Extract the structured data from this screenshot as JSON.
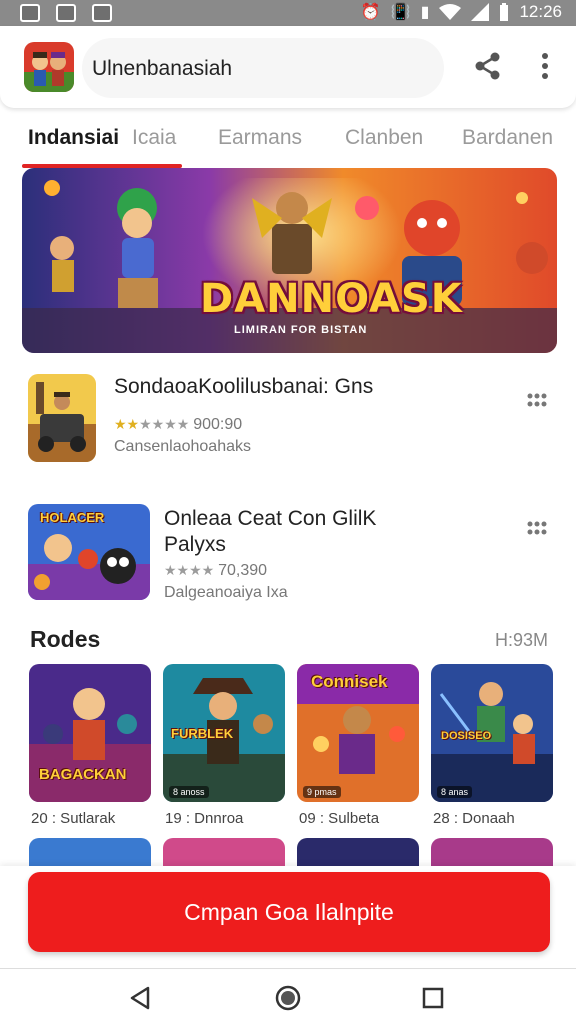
{
  "status_bar": {
    "time": "12:26",
    "icons": [
      "photo-icon",
      "cloud-icon",
      "image-icon",
      "alarm-icon",
      "vibrate-icon",
      "wifi-icon",
      "signal-icon",
      "battery-icon"
    ]
  },
  "app_bar": {
    "title": "Ulnenbanasiah",
    "share_icon": "share-icon",
    "more_icon": "more-vert-icon"
  },
  "tabs": [
    {
      "label": "Indansiai",
      "active": true
    },
    {
      "label": "Icaia",
      "active": false
    },
    {
      "label": "Earmans",
      "active": false
    },
    {
      "label": "Clanben",
      "active": false
    },
    {
      "label": "Bardanen",
      "active": false
    }
  ],
  "banner": {
    "title": "DANNOASK",
    "subtitle": "LIMIRAN FOR BISTAN"
  },
  "list": [
    {
      "title": "SondaoaKoolilusbanai: Gns",
      "rating_text": "900:90",
      "stars_on": 2,
      "subtitle": "Cansenlaohoahaks"
    },
    {
      "title_line1": "Onleaa Ceat Con GlilK",
      "title_line2": "Palyxs",
      "rating_text": "70,390",
      "stars_on": 0,
      "subtitle": "Dalgeanoaiya Ixa",
      "icon_text": "HOLACER"
    }
  ],
  "section": {
    "title": "Rodes",
    "right_text": "H:93M"
  },
  "grid": [
    {
      "label": "20 : Sutlarak",
      "art_text": "BAGACKAN"
    },
    {
      "label": "19 : Dnnroa",
      "art_text": "FURBLEK",
      "tag": "8 anoss"
    },
    {
      "label": "09 : Sulbeta",
      "art_text": "Connisek",
      "tag": "9 pmas"
    },
    {
      "label": "28 : Donaah",
      "art_text": "DOSISEO",
      "tag": "8 anas"
    }
  ],
  "cta": {
    "label": "Cmpan Goa Ilalnpite"
  },
  "nav": {
    "back": "back-icon",
    "home": "home-icon",
    "recents": "recents-icon"
  },
  "colors": {
    "accent": "#ee1d1d",
    "tab_underline": "#e02424",
    "status_bar": "#8a8a8a"
  }
}
